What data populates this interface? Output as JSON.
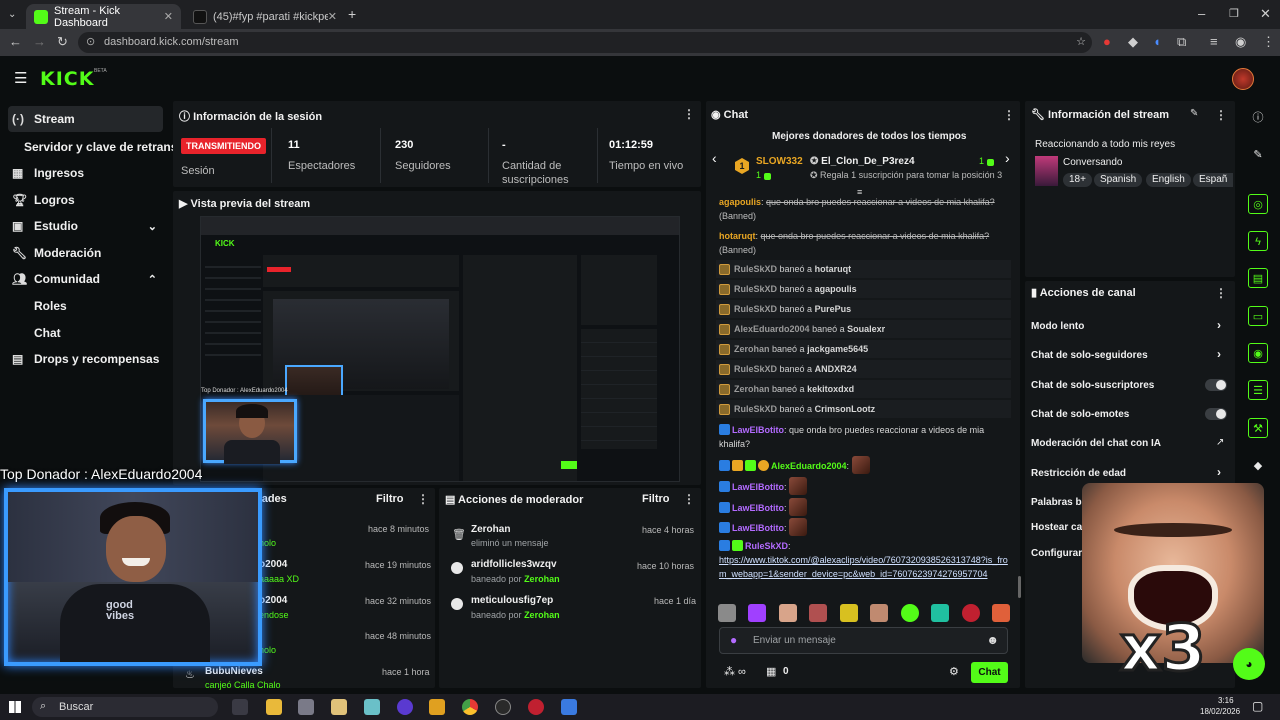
{
  "browser": {
    "tabs": [
      {
        "title": "Stream - Kick Dashboard",
        "active": true
      },
      {
        "title": "(45)#fyp #parati #kickperu #mi",
        "active": false
      }
    ],
    "url": "dashboard.kick.com/stream"
  },
  "kick": {
    "logo": "KICK",
    "beta": "BETA"
  },
  "sidebar": {
    "items": [
      {
        "label": "Stream",
        "icon": "radio-icon",
        "active": true
      },
      {
        "label": "Servidor y clave de retransm",
        "icon": "",
        "active": false
      },
      {
        "label": "Ingresos",
        "icon": "grid-icon",
        "active": false
      },
      {
        "label": "Logros",
        "icon": "trophy-icon",
        "active": false
      },
      {
        "label": "Estudio",
        "icon": "studio-icon",
        "active": false
      },
      {
        "label": "Moderación",
        "icon": "wrench-icon",
        "active": false
      },
      {
        "label": "Comunidad",
        "icon": "people-icon",
        "active": false
      }
    ],
    "community_sub": [
      "Roles",
      "Chat"
    ],
    "drops": "Drops y recompensas"
  },
  "session": {
    "title": "Información de la sesión",
    "live_badge": "TRANSMITIENDO",
    "live_label": "Sesión",
    "stats": [
      {
        "value": "11",
        "label": "Espectadores"
      },
      {
        "value": "230",
        "label": "Seguidores"
      },
      {
        "value": "-",
        "label": "Cantidad de suscripciones"
      },
      {
        "value": "01:12:59",
        "label": "Tiempo en vivo"
      }
    ]
  },
  "preview": {
    "title": "Vista previa del stream"
  },
  "overlay": {
    "top_donor": "Top Donador : AlexEduardo2004"
  },
  "activity": {
    "title_partial": "dades",
    "filter": "Filtro",
    "rows": [
      {
        "name": "",
        "sub": "holo",
        "time": "hace 8 minutos"
      },
      {
        "name": "o2004",
        "sub": "aaaaa XD",
        "time": "hace 19 minutos"
      },
      {
        "name": "o2004",
        "sub": "endose",
        "time": "hace 32 minutos"
      },
      {
        "name": "",
        "sub": "holo",
        "time": "hace 48 minutos"
      },
      {
        "name": "BubuNieves",
        "sub": "canjeó Calla Chalo",
        "time": "hace 1 hora"
      }
    ]
  },
  "mod_actions": {
    "title": "Acciones de moderador",
    "filter": "Filtro",
    "rows": [
      {
        "name": "Zerohan",
        "sub": "eliminó un mensaje",
        "by": "",
        "time": "hace 4 horas"
      },
      {
        "name": "aridfollicles3wzqv",
        "sub": "baneado por",
        "by": "Zerohan",
        "time": "hace 10 horas"
      },
      {
        "name": "meticulousfig7ep",
        "sub": "baneado por",
        "by": "Zerohan",
        "time": "hace 1 día"
      }
    ]
  },
  "chat": {
    "title": "Chat",
    "top_title": "Mejores donadores de todos los tiempos",
    "donor1": {
      "rank": "1",
      "name": "SLOW332",
      "count": "1"
    },
    "donor2": {
      "name": "El_Clon_De_P3rez4",
      "count": "1",
      "hint": "Regala 1 suscripción para tomar la posición 3"
    },
    "msg_banned_1": {
      "user": "agapoulis",
      "text": "que onda bro puedes reaccionar a videos de mia khalifa?",
      "tag": "(Banned)"
    },
    "msg_banned_2": {
      "user": "hotaruqt",
      "text": "que onda bro puedes reaccionar a videos de mia khalifa?",
      "tag": "(Banned)"
    },
    "bans": [
      {
        "mod": "RuleSkXD",
        "verb": "baneó a",
        "target": "hotaruqt"
      },
      {
        "mod": "RuleSkXD",
        "verb": "baneó a",
        "target": "agapoulis"
      },
      {
        "mod": "RuleSkXD",
        "verb": "baneó a",
        "target": "PurePus"
      },
      {
        "mod": "AlexEduardo2004",
        "verb": "baneó a",
        "target": "Soualexr"
      },
      {
        "mod": "Zerohan",
        "verb": "baneó a",
        "target": "jackgame5645"
      },
      {
        "mod": "RuleSkXD",
        "verb": "baneó a",
        "target": "ANDXR24"
      },
      {
        "mod": "Zerohan",
        "verb": "baneó a",
        "target": "kekitoxdxd"
      },
      {
        "mod": "RuleSkXD",
        "verb": "baneó a",
        "target": "CrimsonLootz"
      }
    ],
    "msg_bot": {
      "user": "LawElBotito",
      "text": "que onda bro puedes reaccionar a videos de mia khalifa?"
    },
    "msg_alex": {
      "user": "AlexEduardo2004"
    },
    "msg_bot2": {
      "user": "LawElBotito"
    },
    "msg_bot3": {
      "user": "LawElBotito"
    },
    "msg_bot4": {
      "user": "LawElBotito"
    },
    "msg_rule": {
      "user": "RuleSkXD",
      "link": "https://www.tiktok.com/@alexaclips/video/7607320938526313748?is_from_webapp=1&sender_device=pc&web_id=7607623974276957704"
    },
    "input_placeholder": "Enviar un mensaje",
    "points": "0",
    "send": "Chat"
  },
  "stream_info": {
    "title": "Información del stream",
    "stream_title": "Reaccionando a todo mis reyes",
    "category": "Conversando",
    "tags": [
      "18+",
      "Spanish",
      "English",
      "Españ"
    ]
  },
  "channel_actions": {
    "title": "Acciones de canal",
    "rows": [
      {
        "label": "Modo lento",
        "control": "chevron"
      },
      {
        "label": "Chat de solo-seguidores",
        "control": "chevron"
      },
      {
        "label": "Chat de solo-suscriptores",
        "control": "toggle"
      },
      {
        "label": "Chat de solo-emotes",
        "control": "toggle"
      },
      {
        "label": "Moderación del chat con IA",
        "control": "external"
      },
      {
        "label": "Restricción de edad",
        "control": "chevron"
      },
      {
        "label": "Palabras ba",
        "control": ""
      },
      {
        "label": "Hostear can",
        "control": ""
      },
      {
        "label": "Configurar c",
        "control": ""
      }
    ]
  },
  "meme_overlay": {
    "text": "x3"
  },
  "taskbar": {
    "search": "Buscar",
    "time": "3:16",
    "date": "18/02/2026"
  },
  "colors": {
    "kick_green": "#53fc18",
    "live_red": "#e8232b",
    "link_blue": "#9ac1ff",
    "bot_purple": "#b36bff"
  }
}
